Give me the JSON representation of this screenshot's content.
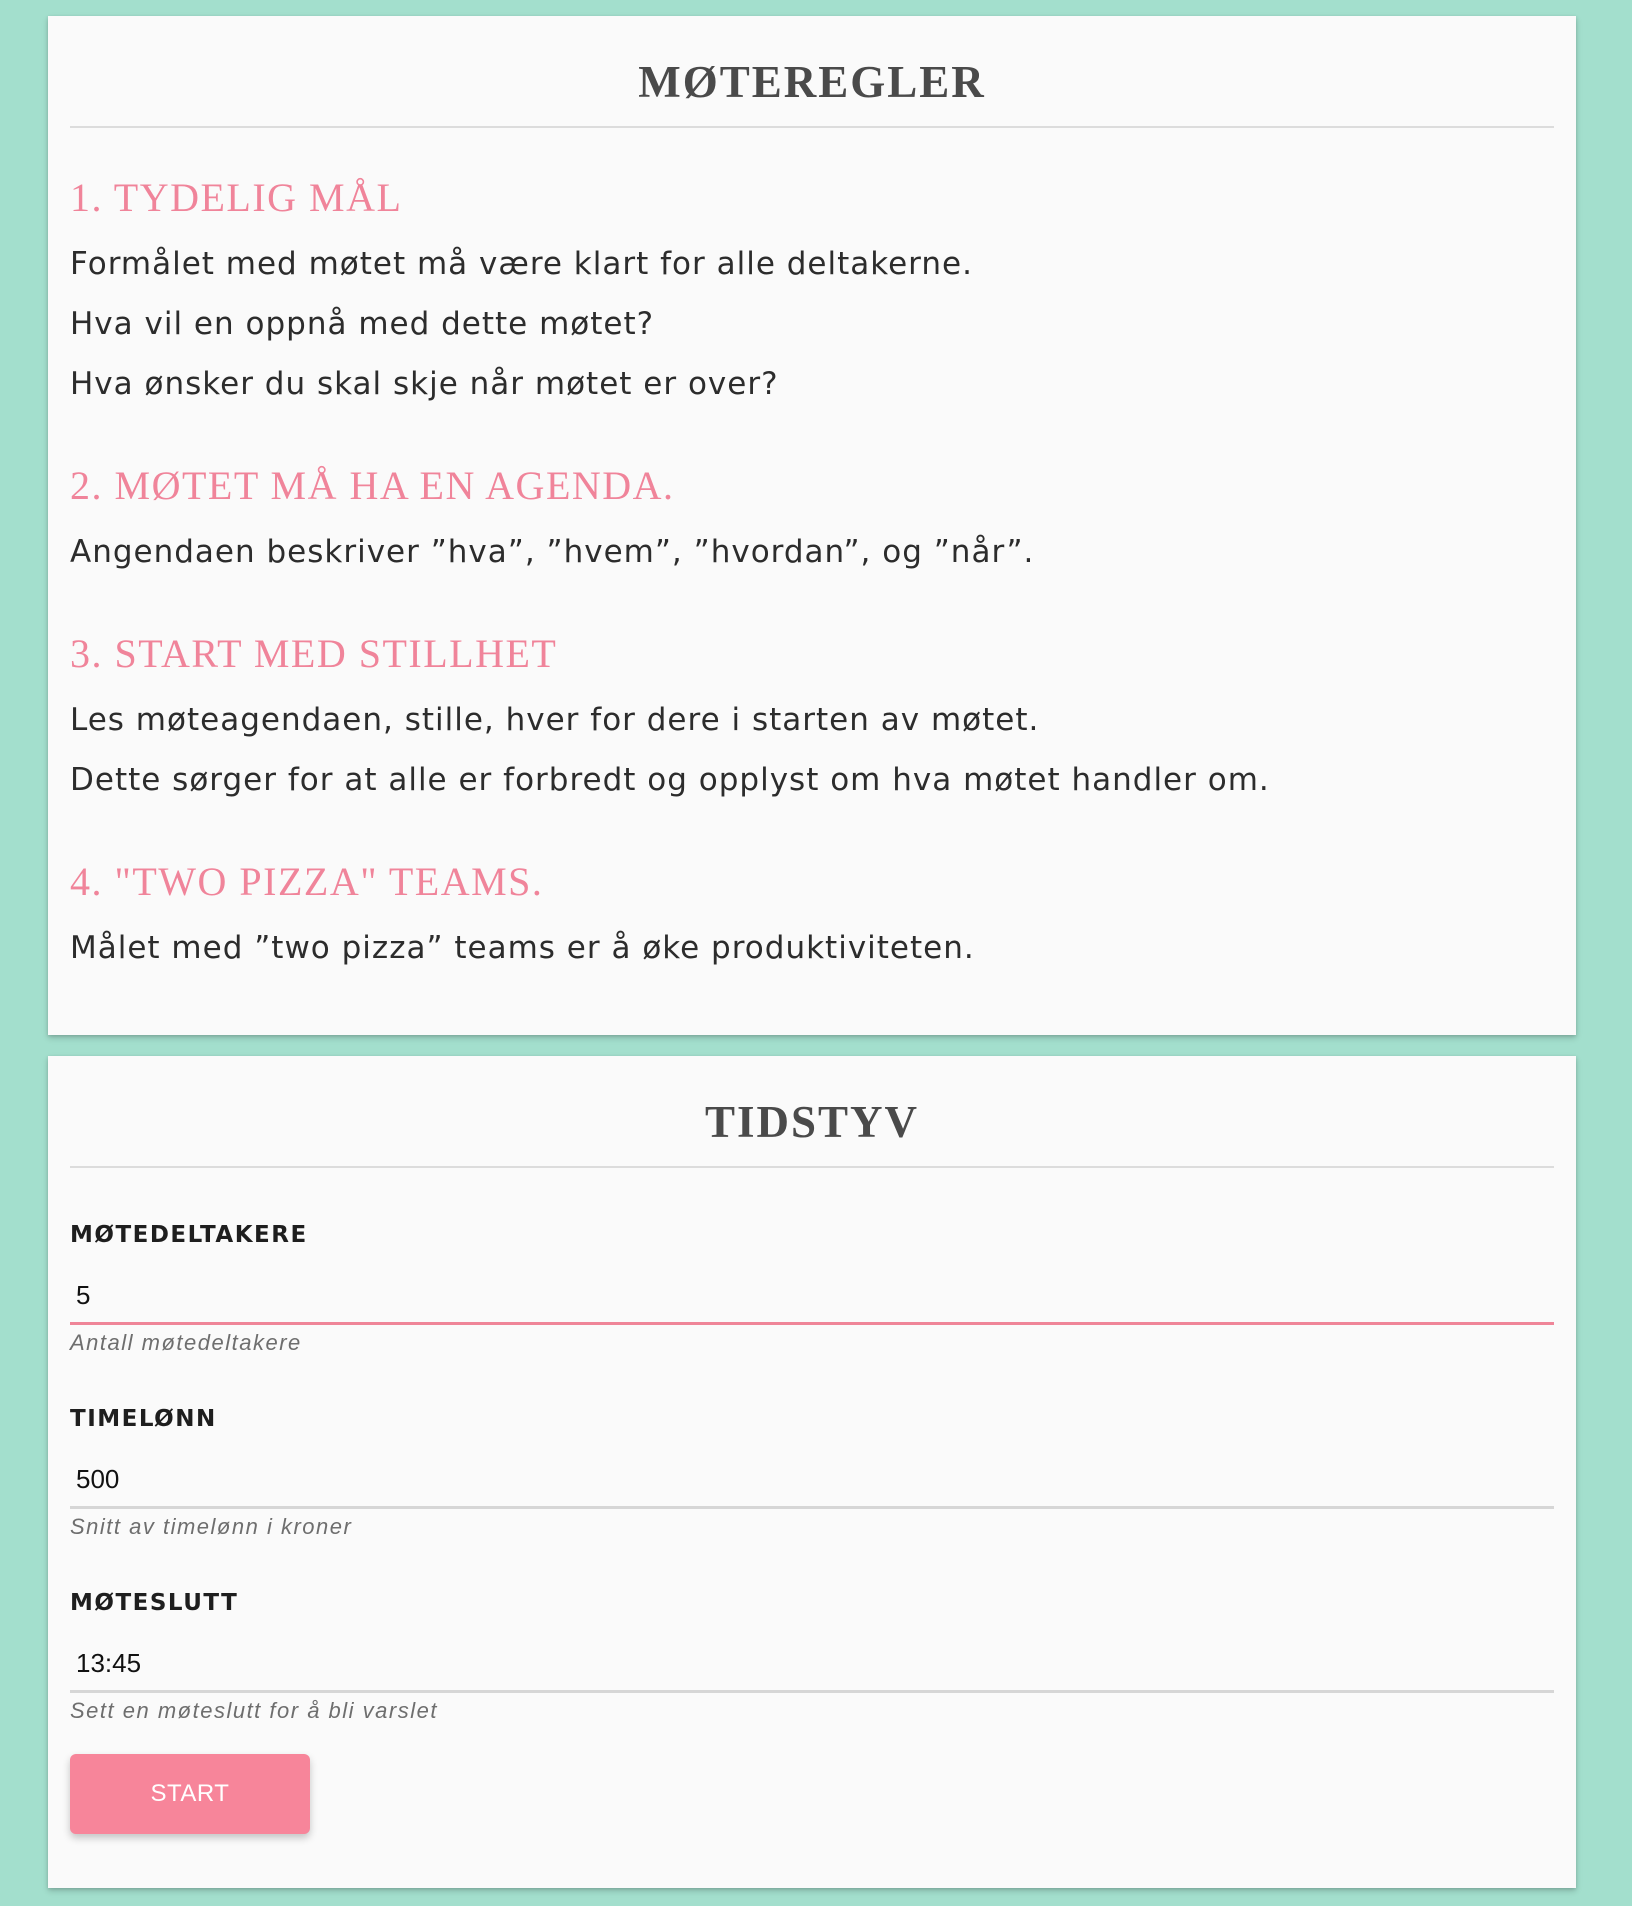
{
  "rules_card": {
    "title": "MØTEREGLER",
    "rules": [
      {
        "heading": "1. TYDELIG MÅL",
        "lines": [
          "Formålet med møtet må være klart for alle deltakerne.",
          "Hva vil en oppnå med dette møtet?",
          "Hva ønsker du skal skje når møtet er over?"
        ]
      },
      {
        "heading": "2. MØTET MÅ HA EN AGENDA.",
        "lines": [
          "Angendaen beskriver ”hva”, ”hvem”, ”hvordan”, og ”når”."
        ]
      },
      {
        "heading": "3. START MED STILLHET",
        "lines": [
          "Les møteagendaen, stille, hver for dere i starten av møtet.",
          "Dette sørger for at alle er forbredt og opplyst om hva møtet handler om."
        ]
      },
      {
        "heading": "4. \"TWO PIZZA\" TEAMS.",
        "lines": [
          "Målet med ”two pizza” teams er å øke produktiviteten."
        ]
      }
    ]
  },
  "timer_card": {
    "title": "TIDSTYV",
    "fields": [
      {
        "label": "MØTEDELTAKERE",
        "value": "5",
        "hint": "Antall møtedeltakere"
      },
      {
        "label": "TIMELØNN",
        "value": "500",
        "hint": "Snitt av timelønn i kroner"
      },
      {
        "label": "MØTESLUTT",
        "value": "13:45",
        "hint": "Sett en møteslutt for å bli varslet"
      }
    ],
    "start_label": "START"
  },
  "colors": {
    "background": "#a3dfcd",
    "card": "#fafafa",
    "accent": "#f7859a",
    "heading": "#f0849a",
    "title": "#4a4a4a"
  }
}
